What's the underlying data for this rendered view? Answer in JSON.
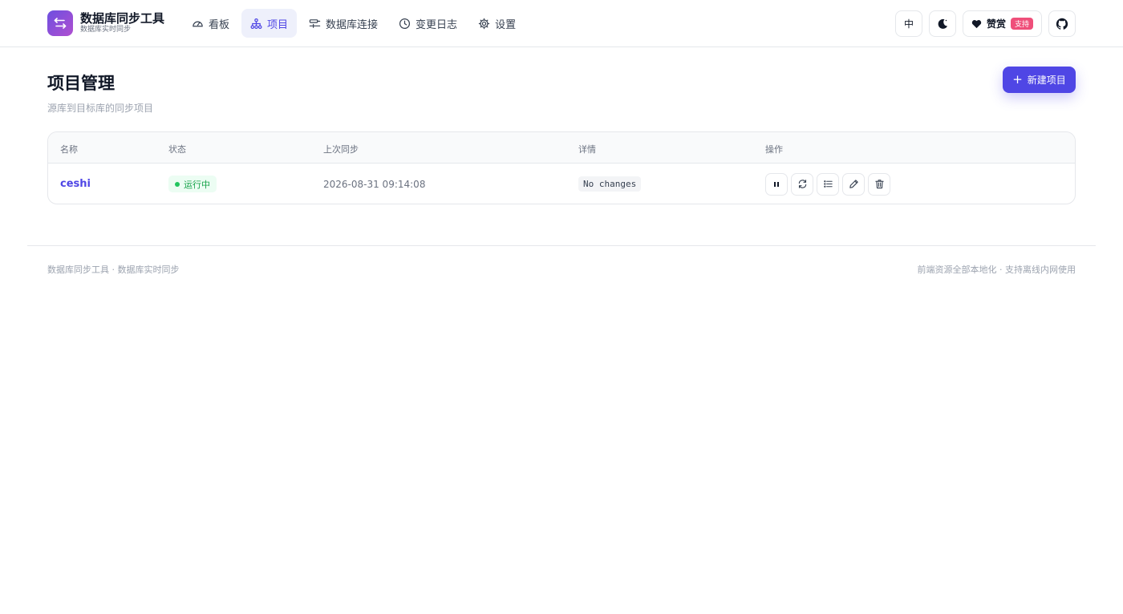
{
  "brand": {
    "title": "数据库同步工具",
    "subtitle": "数据库实时同步"
  },
  "nav": {
    "items": [
      {
        "label": "看板",
        "icon": "dashboard-gauge-icon",
        "active": false
      },
      {
        "label": "项目",
        "icon": "project-tree-icon",
        "active": true
      },
      {
        "label": "数据库连接",
        "icon": "connection-icon",
        "active": false
      },
      {
        "label": "变更日志",
        "icon": "clock-icon",
        "active": false
      },
      {
        "label": "设置",
        "icon": "gear-icon",
        "active": false
      }
    ]
  },
  "toolbar": {
    "language": "中",
    "theme_icon": "moon-icon",
    "sponsor_label": "赞赏",
    "sponsor_badge": "支持",
    "github_icon": "github-icon"
  },
  "page": {
    "title": "项目管理",
    "subtitle": "源库到目标库的同步项目",
    "new_button_label": "新建项目"
  },
  "table": {
    "headers": {
      "name": "名称",
      "status": "状态",
      "last_sync": "上次同步",
      "detail": "详情",
      "actions": "操作"
    },
    "rows": [
      {
        "name": "ceshi",
        "status": "运行中",
        "last_sync": "2026-08-31 09:14:08",
        "detail": "No changes",
        "actions": [
          "pause-icon",
          "sync-icon",
          "list-icon",
          "edit-icon",
          "trash-icon"
        ]
      }
    ]
  },
  "footer": {
    "left": "数据库同步工具 · 数据库实时同步",
    "right": "前端资源全部本地化 · 支持离线内网使用"
  },
  "colors": {
    "accent": "#4f46e5",
    "status_running": "#16a34a",
    "sponsor_badge": "#ef4f7a"
  }
}
